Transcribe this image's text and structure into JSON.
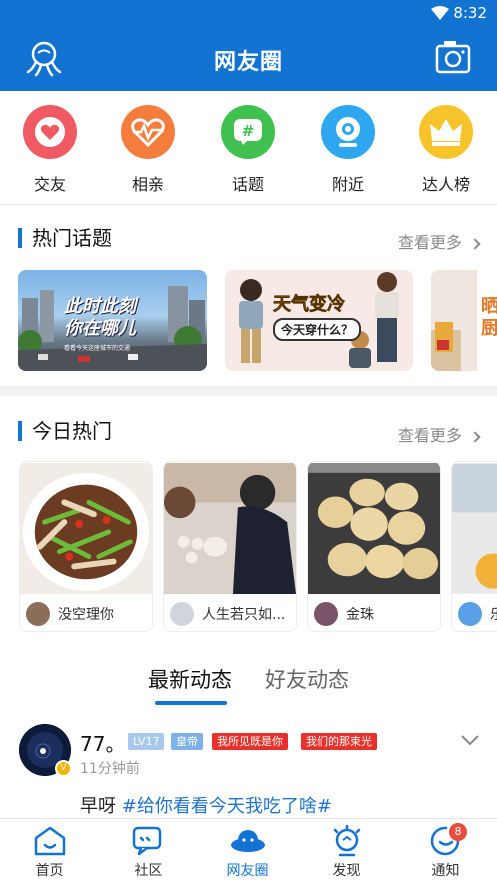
{
  "status_bar": {
    "time": "8:32"
  },
  "header": {
    "title": "网友圈"
  },
  "quick_links": [
    {
      "label": "交友",
      "icon": "heart-icon",
      "color": "#f25a63"
    },
    {
      "label": "相亲",
      "icon": "heartbeat-icon",
      "color": "#f47c3c"
    },
    {
      "label": "话题",
      "icon": "hashtag-icon",
      "color": "#3fc04f"
    },
    {
      "label": "附近",
      "icon": "location-icon",
      "color": "#2fa7f0"
    },
    {
      "label": "达人榜",
      "icon": "crown-icon",
      "color": "#f7c32b"
    }
  ],
  "hot_topics": {
    "title": "热门话题",
    "see_more": "查看更多",
    "cards": [
      {
        "headline": "此时此刻\n你在哪儿",
        "caption": "看看今天这座城市的交通"
      },
      {
        "headline": "天气变冷",
        "sub": "今天穿什么？"
      },
      {
        "headline": "晒\n厨"
      }
    ]
  },
  "today_hot": {
    "title": "今日热门",
    "see_more": "查看更多",
    "items": [
      {
        "user": "没空理你"
      },
      {
        "user": "人生若只如..."
      },
      {
        "user": "金珠"
      },
      {
        "user": "乐"
      }
    ]
  },
  "feed_tabs": {
    "latest": "最新动态",
    "friends": "好友动态"
  },
  "post": {
    "username": "77。",
    "tags": [
      "LV17",
      "皇帝",
      "我所见既是你",
      "我们的那束光"
    ],
    "time": "11分钟前",
    "text": "早呀",
    "topic": "#给你看看今天我吃了啥#"
  },
  "tab_bar": [
    {
      "label": "首页",
      "icon": "home-icon"
    },
    {
      "label": "社区",
      "icon": "chat-icon"
    },
    {
      "label": "网友圈",
      "icon": "planet-icon"
    },
    {
      "label": "发现",
      "icon": "discover-icon"
    },
    {
      "label": "通知",
      "icon": "notification-icon",
      "badge": "8"
    }
  ],
  "colors": {
    "primary": "#1273d3",
    "topic_link": "#1f73cf",
    "badge": "#e84c3d"
  }
}
